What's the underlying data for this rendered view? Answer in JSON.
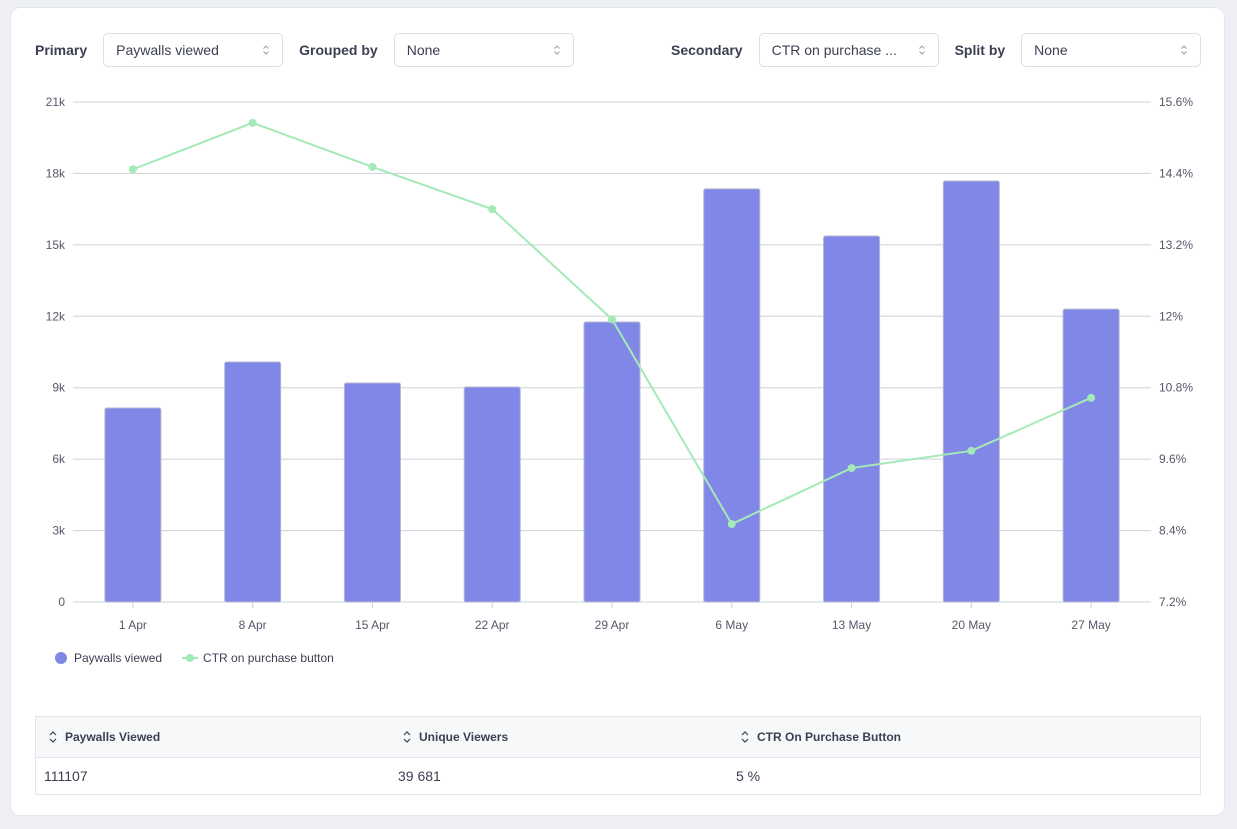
{
  "controls": {
    "primary_label": "Primary",
    "primary_value": "Paywalls viewed",
    "grouped_by_label": "Grouped by",
    "grouped_by_value": "None",
    "secondary_label": "Secondary",
    "secondary_value": "CTR on purchase ...",
    "split_by_label": "Split by",
    "split_by_value": "None"
  },
  "colors": {
    "bar": "#8087e6",
    "line": "#a4e9b8",
    "grid": "#cfd0d6"
  },
  "legend": {
    "primary": "Paywalls viewed",
    "secondary": "CTR on purchase button"
  },
  "chart_data": {
    "type": "bar",
    "title": "",
    "xlabel": "",
    "ylabel": "Paywalls viewed",
    "y2label": "CTR on purchase button",
    "categories": [
      "1 Apr",
      "8 Apr",
      "15 Apr",
      "22 Apr",
      "29 Apr",
      "6 May",
      "13 May",
      "20 May",
      "27 May"
    ],
    "series": [
      {
        "name": "Paywalls viewed",
        "type": "bar",
        "axis": "left",
        "values": [
          8150,
          10080,
          9200,
          9030,
          11760,
          17350,
          15370,
          17680,
          12300
        ]
      },
      {
        "name": "CTR on purchase button",
        "type": "line",
        "axis": "right",
        "values": [
          14.47,
          15.25,
          14.51,
          13.8,
          11.95,
          8.51,
          9.45,
          9.74,
          10.63
        ]
      }
    ],
    "ylim": [
      0,
      21000
    ],
    "y_ticks": [
      0,
      3000,
      6000,
      9000,
      12000,
      15000,
      18000,
      21000
    ],
    "y_tick_labels": [
      "0",
      "3k",
      "6k",
      "9k",
      "12k",
      "15k",
      "18k",
      "21k"
    ],
    "y2lim": [
      7.2,
      15.6
    ],
    "y2_ticks": [
      7.2,
      8.4,
      9.6,
      10.8,
      12,
      13.2,
      14.4,
      15.6
    ],
    "y2_tick_labels": [
      "7.2%",
      "8.4%",
      "9.6%",
      "10.8%",
      "12%",
      "13.2%",
      "14.4%",
      "15.6%"
    ],
    "grid": true,
    "legend_position": "bottom-left"
  },
  "table": {
    "headers": [
      "Paywalls Viewed",
      "Unique Viewers",
      "CTR On Purchase Button"
    ],
    "rows": [
      [
        "111107",
        "39681",
        "5 %"
      ]
    ],
    "display_rows": [
      [
        "111107",
        "39 681",
        "5 %"
      ]
    ]
  }
}
